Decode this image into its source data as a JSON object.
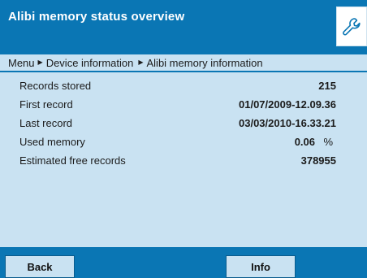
{
  "header": {
    "title": "Alibi memory status overview",
    "tool_icon": "wrench-icon"
  },
  "breadcrumb": {
    "items": [
      "Menu",
      "Device information",
      "Alibi memory information"
    ],
    "separator_icon": "triangle-right-icon"
  },
  "rows": [
    {
      "label": "Records stored",
      "value": "215",
      "unit": ""
    },
    {
      "label": "First record",
      "value": "01/07/2009-12.09.36",
      "unit": ""
    },
    {
      "label": "Last record",
      "value": "03/03/2010-16.33.21",
      "unit": ""
    },
    {
      "label": "Used memory",
      "value": "0.06",
      "unit": "%"
    },
    {
      "label": "Estimated free records",
      "value": "378955",
      "unit": ""
    }
  ],
  "footer": {
    "back_label": "Back",
    "info_label": "Info"
  },
  "colors": {
    "accent": "#0a76b4",
    "panel": "#c9e2f2"
  }
}
